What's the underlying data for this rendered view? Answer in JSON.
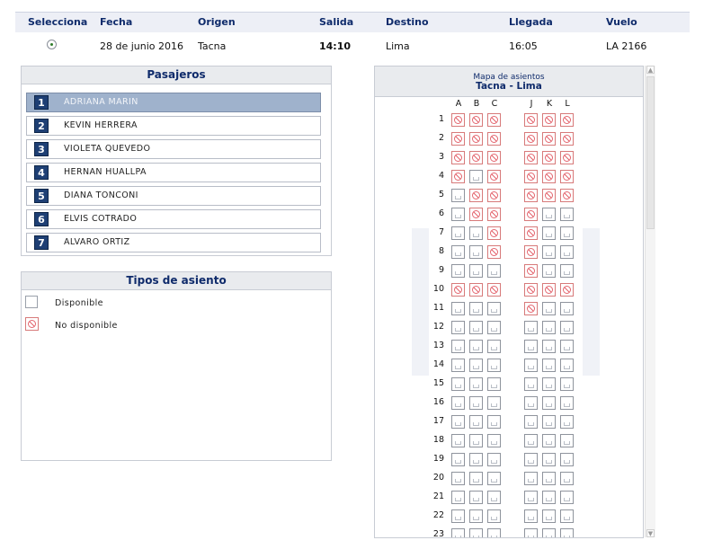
{
  "flight": {
    "headers": {
      "select": "Selecciona",
      "date": "Fecha",
      "origin": "Origen",
      "departure": "Salida",
      "destination": "Destino",
      "arrival": "Llegada",
      "flight": "Vuelo"
    },
    "row": {
      "date": "28 de junio 2016",
      "origin": "Tacna",
      "departure": "14:10",
      "destination": "Lima",
      "arrival": "16:05",
      "flight": "LA 2166",
      "selected": true
    }
  },
  "passengers": {
    "title": "Pasajeros",
    "selected_index": 0,
    "items": [
      {
        "num": "1",
        "name": "ADRIANA MARIN"
      },
      {
        "num": "2",
        "name": "KEVIN HERRERA"
      },
      {
        "num": "3",
        "name": "VIOLETA QUEVEDO"
      },
      {
        "num": "4",
        "name": "HERNAN HUALLPA"
      },
      {
        "num": "5",
        "name": "DIANA TONCONI"
      },
      {
        "num": "6",
        "name": "ELVIS COTRADO"
      },
      {
        "num": "7",
        "name": "ALVARO ORTIZ"
      }
    ]
  },
  "seat_types": {
    "title": "Tipos de asiento",
    "available": "Disponible",
    "unavailable": "No disponible"
  },
  "seat_map": {
    "title": "Mapa de asientos",
    "route": "Tacna - Lima",
    "columns": [
      "A",
      "B",
      "C",
      "J",
      "K",
      "L"
    ],
    "rows": [
      {
        "n": "1",
        "seats": "XXXXXX"
      },
      {
        "n": "2",
        "seats": "XXXXXX"
      },
      {
        "n": "3",
        "seats": "XXXXXX"
      },
      {
        "n": "4",
        "seats": "X.XXXX"
      },
      {
        "n": "5",
        "seats": ".XXXXX"
      },
      {
        "n": "6",
        "seats": ".XXX.."
      },
      {
        "n": "7",
        "seats": "..XX.."
      },
      {
        "n": "8",
        "seats": "..XX.."
      },
      {
        "n": "9",
        "seats": "...X.."
      },
      {
        "n": "10",
        "seats": "XXXXXX"
      },
      {
        "n": "11",
        "seats": "...X.."
      },
      {
        "n": "12",
        "seats": "......"
      },
      {
        "n": "13",
        "seats": "......"
      },
      {
        "n": "14",
        "seats": "......"
      },
      {
        "n": "15",
        "seats": "......"
      },
      {
        "n": "16",
        "seats": "......"
      },
      {
        "n": "17",
        "seats": "......"
      },
      {
        "n": "18",
        "seats": "......"
      },
      {
        "n": "19",
        "seats": "......"
      },
      {
        "n": "20",
        "seats": "......"
      },
      {
        "n": "21",
        "seats": "......"
      },
      {
        "n": "22",
        "seats": "......"
      },
      {
        "n": "23",
        "seats": "......"
      }
    ]
  },
  "colors": {
    "header_text": "#0f2b6b",
    "selected_row": "#9fb2cc",
    "number_badge": "#1e3f74",
    "unavailable": "#e4666f"
  }
}
